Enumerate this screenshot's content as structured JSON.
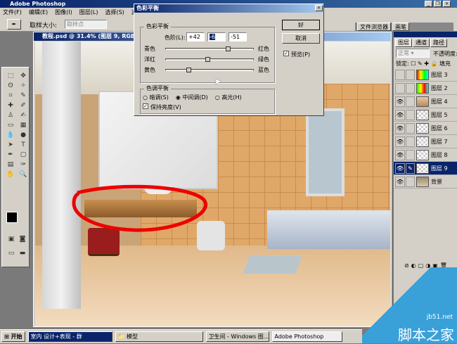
{
  "app": {
    "title": "Adobe Photoshop"
  },
  "menu": [
    "文件(F)",
    "编辑(E)",
    "图像(I)",
    "图层(L)",
    "选择(S)",
    "滤镜"
  ],
  "options": {
    "sample_size_label": "取样大小:",
    "sample_size_value": "取样点"
  },
  "palette_well": {
    "tabs": [
      "文件浏览器",
      "画笔"
    ]
  },
  "document": {
    "title": "教程.psd @ 31.4% (图层 9, RGB"
  },
  "dialog": {
    "title": "色彩平衡",
    "color_balance_group": "色彩平衡",
    "levels_label": "色阶(L):",
    "levels": [
      "+42",
      "-6",
      "-51"
    ],
    "sliders": [
      {
        "left": "青色",
        "right": "红色",
        "value": 42
      },
      {
        "left": "洋红",
        "right": "绿色",
        "value": -6
      },
      {
        "left": "黄色",
        "right": "蓝色",
        "value": -51
      }
    ],
    "tone_group": "色调平衡",
    "tones": [
      "暗调(S)",
      "中间调(D)",
      "高光(H)"
    ],
    "selected_tone": "中间调(D)",
    "preserve_luminosity": "保持亮度(V)",
    "ok": "好",
    "cancel": "取消",
    "preview": "预览(P)"
  },
  "layers_panel": {
    "tabs": [
      "图层",
      "通道",
      "路径"
    ],
    "blend_mode": "正常",
    "opacity_label": "不透明度:",
    "lock_label": "锁定:",
    "fill_label": "填充",
    "layers": [
      {
        "name": "图层 3",
        "visible": false,
        "selected": false
      },
      {
        "name": "图层 2",
        "visible": false,
        "selected": false
      },
      {
        "name": "图层 4",
        "visible": true,
        "selected": false
      },
      {
        "name": "图层 5",
        "visible": true,
        "selected": false
      },
      {
        "name": "图层 6",
        "visible": true,
        "selected": false
      },
      {
        "name": "图层 7",
        "visible": true,
        "selected": false
      },
      {
        "name": "图层 8",
        "visible": true,
        "selected": false
      },
      {
        "name": "图层 9",
        "visible": true,
        "selected": true
      },
      {
        "name": "背景",
        "visible": true,
        "selected": false
      }
    ]
  },
  "taskbar": {
    "start": "开始",
    "items": [
      "室内 设计+表现 - 群",
      "模型",
      "卫生间 - Windows 图...",
      "Adobe Photoshop"
    ]
  },
  "watermark": {
    "site": "jb51.net",
    "name": "脚本之家"
  }
}
